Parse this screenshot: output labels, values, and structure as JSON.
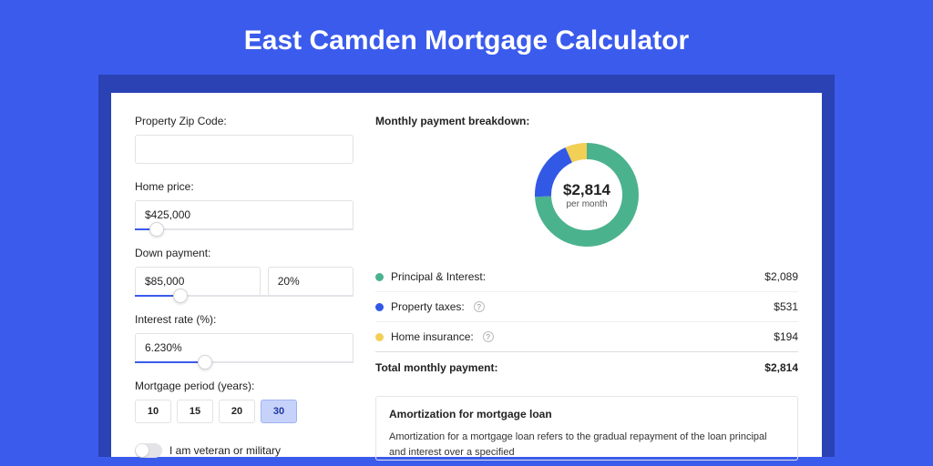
{
  "title": "East Camden Mortgage Calculator",
  "left": {
    "zip_label": "Property Zip Code:",
    "zip_value": "",
    "home_price_label": "Home price:",
    "home_price_value": "$425,000",
    "home_price_slider_pct": 10,
    "down_payment_label": "Down payment:",
    "down_payment_value": "$85,000",
    "down_payment_pct_value": "20%",
    "down_payment_slider_pct": 21,
    "interest_label": "Interest rate (%):",
    "interest_value": "6.230%",
    "interest_slider_pct": 32,
    "period_label": "Mortgage period (years):",
    "period_options": [
      "10",
      "15",
      "20",
      "30"
    ],
    "period_active": "30",
    "veteran_label": "I am veteran or military"
  },
  "right": {
    "breakdown_title": "Monthly payment breakdown:",
    "donut_value": "$2,814",
    "donut_sub": "per month",
    "items": [
      {
        "label": "Principal & Interest:",
        "value": "$2,089",
        "color": "#4bb28e",
        "help": false
      },
      {
        "label": "Property taxes:",
        "value": "$531",
        "color": "#3258e6",
        "help": true
      },
      {
        "label": "Home insurance:",
        "value": "$194",
        "color": "#f2cf55",
        "help": true
      }
    ],
    "total_label": "Total monthly payment:",
    "total_value": "$2,814",
    "amort_title": "Amortization for mortgage loan",
    "amort_text": "Amortization for a mortgage loan refers to the gradual repayment of the loan principal and interest over a specified"
  },
  "chart_data": {
    "type": "pie",
    "title": "Monthly payment breakdown",
    "series": [
      {
        "name": "Principal & Interest",
        "value": 2089,
        "color": "#4bb28e"
      },
      {
        "name": "Property taxes",
        "value": 531,
        "color": "#3258e6"
      },
      {
        "name": "Home insurance",
        "value": 194,
        "color": "#f2cf55"
      }
    ],
    "total": 2814,
    "center_label": "$2,814 per month"
  }
}
